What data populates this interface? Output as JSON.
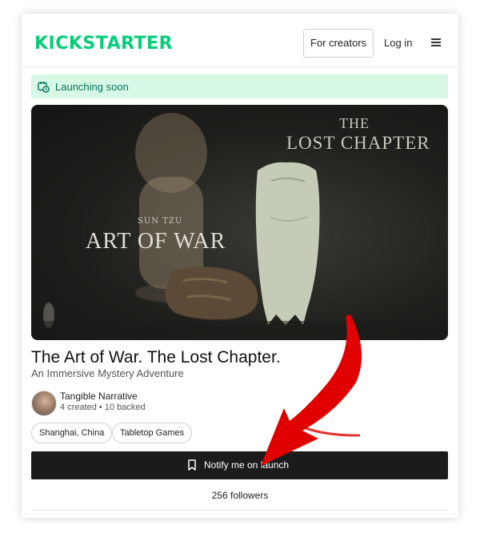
{
  "header": {
    "logo_text": "KICKSTARTER",
    "creators_label": "For creators",
    "login_label": "Log in",
    "menu_icon": "hamburger-menu-icon"
  },
  "status": {
    "label": "Launching soon",
    "icon": "calendar-clock-icon"
  },
  "hero": {
    "small_text": "SUN TZU",
    "big_text": "ART OF WAR",
    "right_top_text": "THE",
    "right_text": "LOST CHAPTER"
  },
  "project": {
    "title": "The Art of War. The Lost Chapter.",
    "subtitle": "An Immersive Mystery Adventure"
  },
  "creator": {
    "name": "Tangible Narrative",
    "stats": "4 created • 10 backed"
  },
  "tags": [
    "Shanghai, China",
    "Tabletop Games"
  ],
  "notify": {
    "label": "Notify me on launch",
    "icon": "bookmark-icon"
  },
  "followers": "256 followers",
  "colors": {
    "brand_green": "#05ce78",
    "banner_bg": "#d7f8e4",
    "banner_text": "#037362",
    "button_dark": "#1b1b1b",
    "annotation_red": "#e00000"
  }
}
